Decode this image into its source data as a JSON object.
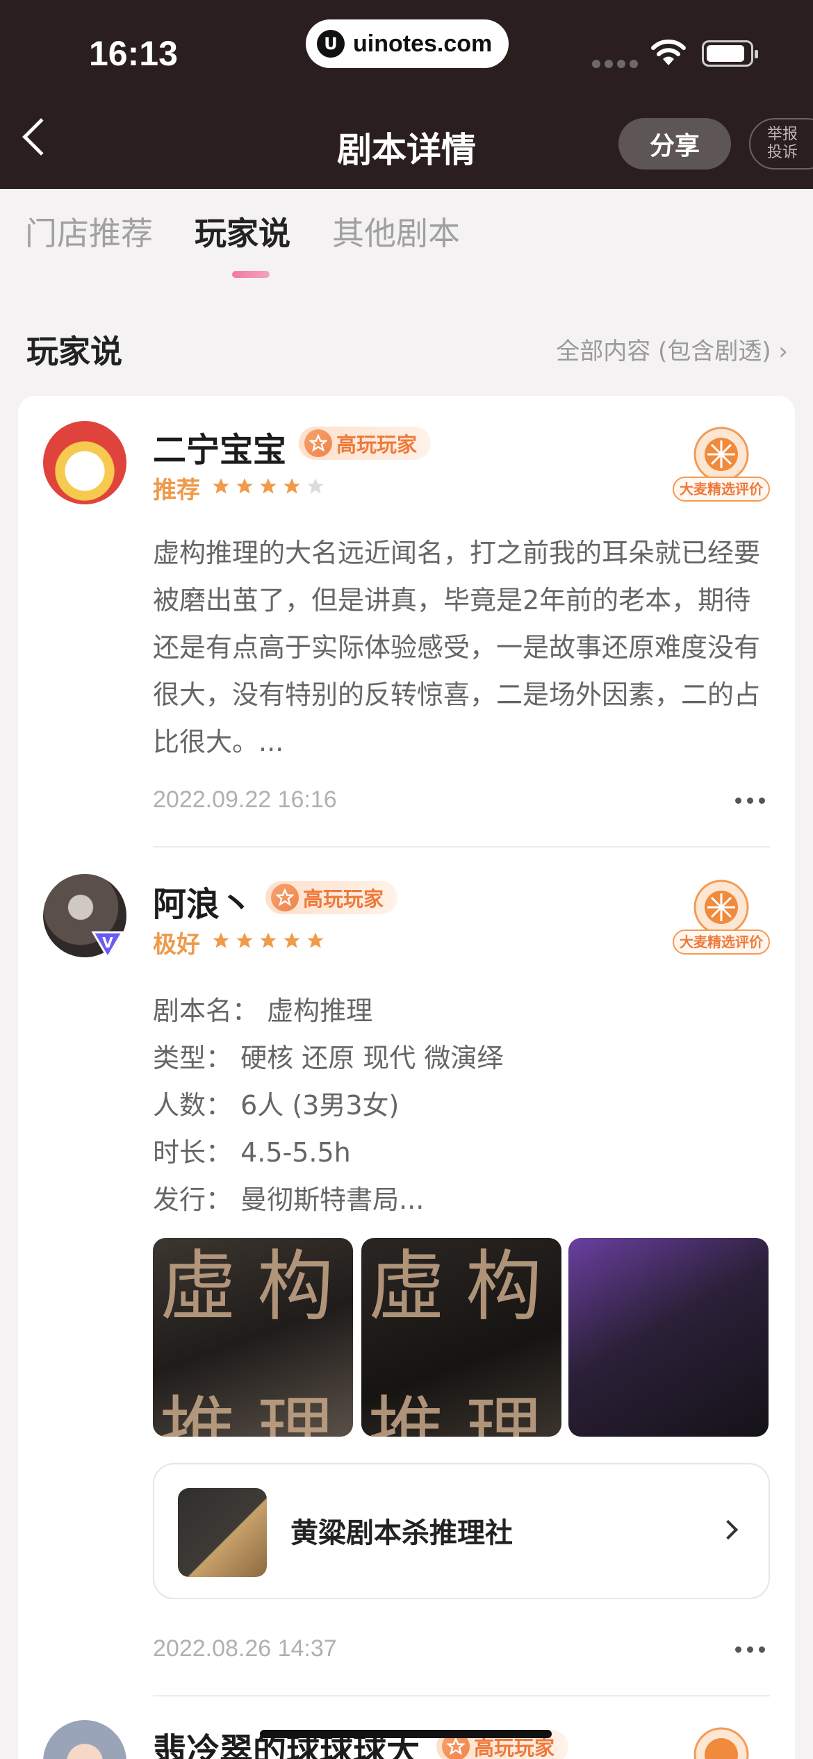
{
  "status": {
    "time": "16:13",
    "url": "uinotes.com"
  },
  "header": {
    "title": "剧本详情",
    "share": "分享",
    "report": "举报投诉"
  },
  "tabs": [
    "门店推荐",
    "玩家说",
    "其他剧本"
  ],
  "section": {
    "title": "玩家说",
    "more": "全部内容 (包含剧透) ›"
  },
  "reviews": [
    {
      "name": "二宁宝宝",
      "badge": "高玩玩家",
      "rating_label": "推荐",
      "rating": 4,
      "seal": "大麦精选评价",
      "text": "虚构推理的大名远近闻名，打之前我的耳朵就已经要被磨出茧了，但是讲真，毕竟是2年前的老本，期待还是有点高于实际体验感受，一是故事还原难度没有很大，没有特别的反转惊喜，二是场外因素，二的占比很大。...",
      "time": "2022.09.22 16:16"
    },
    {
      "name": "阿浪丶",
      "badge": "高玩玩家",
      "rating_label": "极好",
      "rating": 5,
      "seal": "大麦精选评价",
      "info": [
        "剧本名：  虚构推理",
        "类型：  硬核 还原 现代 微演绎",
        "人数：  6人 (3男3女)",
        "时长：  4.5-5.5h",
        "发行：  曼彻斯特書局..."
      ],
      "store": "黄粱剧本杀推理社",
      "time": "2022.08.26 14:37"
    },
    {
      "name": "翡冷翠的球球球大",
      "badge": "高玩玩家"
    }
  ]
}
